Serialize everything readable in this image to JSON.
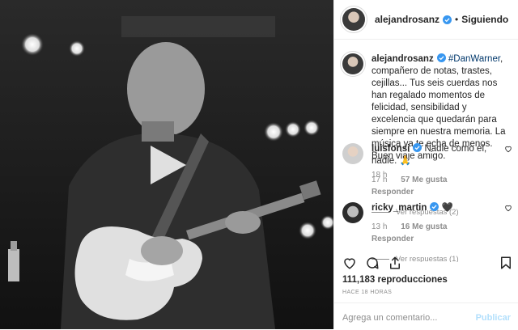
{
  "post": {
    "username": "alejandrosanz",
    "follow_status": "Siguiendo",
    "separator": "•"
  },
  "caption": {
    "username": "alejandrosanz",
    "hashtag": "#DanWarner",
    "text": ", compañero de notas, trastes, cejillas... Tus seis cuerdas nos han regalado momentos de felicidad, sensibilidad y excelencia que quedarán para siempre en nuestra memoria. La música ya te echa de menos. Buen viaje amigo.",
    "time": "18 h"
  },
  "comments": [
    {
      "username": "luisfonsi",
      "text": "Nadie como el, nadie.",
      "emoji": "🙏",
      "time": "17 h",
      "likes": "57 Me gusta",
      "reply": "Responder",
      "view_replies": "Ver respuestas (2)"
    },
    {
      "username": "ricky_martin",
      "text": "",
      "emoji": "🖤",
      "time": "13 h",
      "likes": "16 Me gusta",
      "reply": "Responder",
      "view_replies": "Ver respuestas (1)"
    }
  ],
  "stats": {
    "views": "111,183 reproducciones",
    "posted": "HACE 18 HORAS"
  },
  "add_comment": {
    "placeholder": "Agrega un comentario...",
    "publish": "Publicar"
  },
  "icons": {
    "verified": "verified-badge-icon",
    "play": "play-icon",
    "like": "heart-icon",
    "comment": "comment-icon",
    "share": "share-icon",
    "save": "bookmark-icon"
  },
  "colors": {
    "verified_blue": "#3897f0",
    "link": "#00376b",
    "muted": "#8e8e8e",
    "publish_disabled": "#b2dffc"
  }
}
